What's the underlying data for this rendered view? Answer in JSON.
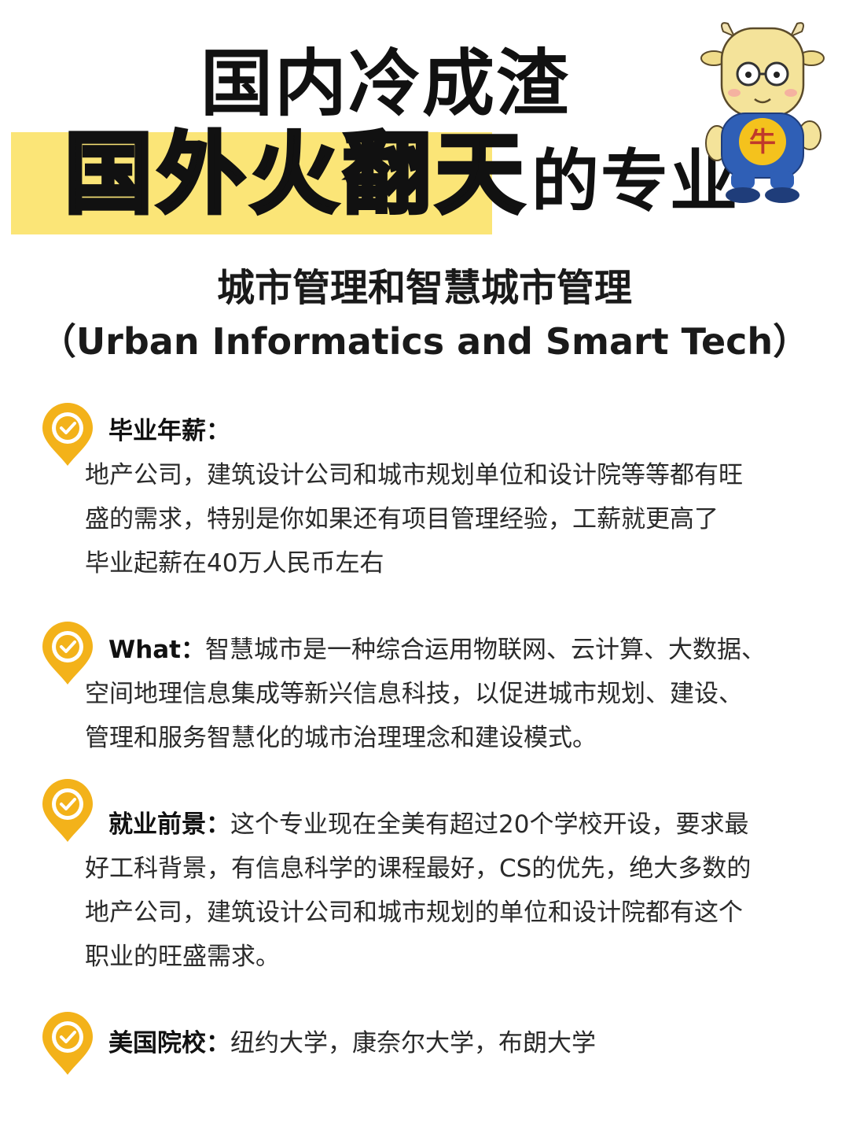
{
  "header": {
    "title_line1": "国内冷成渣",
    "title_line2_highlight": "国外火翻天",
    "title_line2_rest": "的专业",
    "mascot_badge": "牛",
    "colors": {
      "highlight": "#fbe577",
      "accent": "#f3b21a"
    }
  },
  "subtitle": {
    "chinese": "城市管理和智慧城市管理",
    "english": "（Urban Informatics and Smart Tech）"
  },
  "sections": [
    {
      "icon": "location-check-icon",
      "heading": "毕业年薪：",
      "first_line": "",
      "lines": [
        "地产公司，建筑设计公司和城市规划单位和设计院等等都有旺",
        "盛的需求，特别是你如果还有项目管理经验，工薪就更高了",
        "毕业起薪在40万人民币左右"
      ]
    },
    {
      "icon": "location-check-icon",
      "heading": "What：",
      "first_line": "智慧城市是一种综合运用物联网、云计算、大数据、",
      "lines": [
        "空间地理信息集成等新兴信息科技，以促进城市规划、建设、",
        "管理和服务智慧化的城市治理理念和建设模式。"
      ]
    },
    {
      "icon": "location-check-icon",
      "heading": "就业前景：",
      "first_line": "这个专业现在全美有超过20个学校开设，要求最",
      "lines": [
        "好工科背景，有信息科学的课程最好，CS的优先，绝大多数的",
        "地产公司，建筑设计公司和城市规划的单位和设计院都有这个",
        "职业的旺盛需求。"
      ]
    },
    {
      "icon": "location-check-icon",
      "heading": "美国院校：",
      "first_line": "纽约大学，康奈尔大学，布朗大学",
      "lines": []
    }
  ]
}
